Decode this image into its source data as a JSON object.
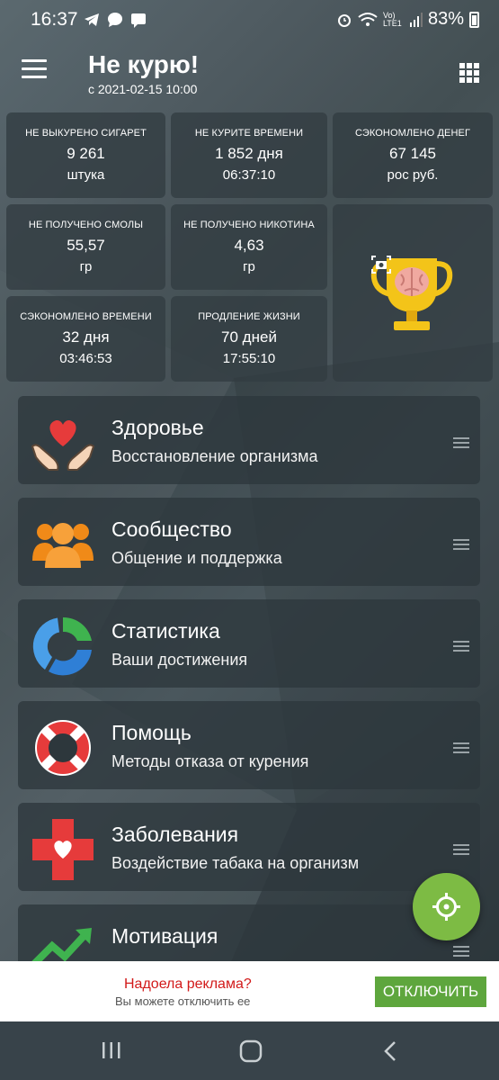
{
  "status_bar": {
    "time": "16:37",
    "battery_text": "83%",
    "network_text": "Vo) LTE1"
  },
  "app_bar": {
    "title": "Не курю!",
    "subtitle": "с 2021-02-15 10:00"
  },
  "stats": [
    {
      "label": "НЕ ВЫКУРЕНО СИГАРЕТ",
      "value": "9 261",
      "unit": "штука"
    },
    {
      "label": "НЕ КУРИТЕ ВРЕМЕНИ",
      "value": "1 852 дня",
      "unit": "06:37:10"
    },
    {
      "label": "СЭКОНОМЛЕНО ДЕНЕГ",
      "value": "67 145",
      "unit": "рос руб."
    },
    {
      "label": "НЕ ПОЛУЧЕНО СМОЛЫ",
      "value": "55,57",
      "unit": "гр"
    },
    {
      "label": "НЕ ПОЛУЧЕНО НИКОТИНА",
      "value": "4,63",
      "unit": "гр"
    },
    {
      "label": "СЭКОНОМЛЕНО ВРЕМЕНИ",
      "value": "32 дня",
      "unit": "03:46:53"
    },
    {
      "label": "ПРОДЛЕНИЕ ЖИЗНИ",
      "value": "70 дней",
      "unit": "17:55:10"
    }
  ],
  "menu": [
    {
      "title": "Здоровье",
      "subtitle": "Восстановление организма",
      "icon": "heart-hands-icon"
    },
    {
      "title": "Сообщество",
      "subtitle": "Общение и поддержка",
      "icon": "people-icon"
    },
    {
      "title": "Статистика",
      "subtitle": "Ваши достижения",
      "icon": "stats-ring-icon"
    },
    {
      "title": "Помощь",
      "subtitle": "Методы отказа от курения",
      "icon": "lifebuoy-icon"
    },
    {
      "title": "Заболевания",
      "subtitle": "Воздействие табака на организм",
      "icon": "medical-cross-icon"
    },
    {
      "title": "Мотивация",
      "subtitle": "",
      "icon": "growth-chart-icon"
    }
  ],
  "ad": {
    "title": "Надоела реклама?",
    "subtitle": "Вы можете отключить ее",
    "button": "ОТКЛЮЧИТЬ"
  },
  "colors": {
    "accent_green": "#7dbb44",
    "ad_button": "#5ea63d",
    "ad_title": "#d21a1a"
  }
}
